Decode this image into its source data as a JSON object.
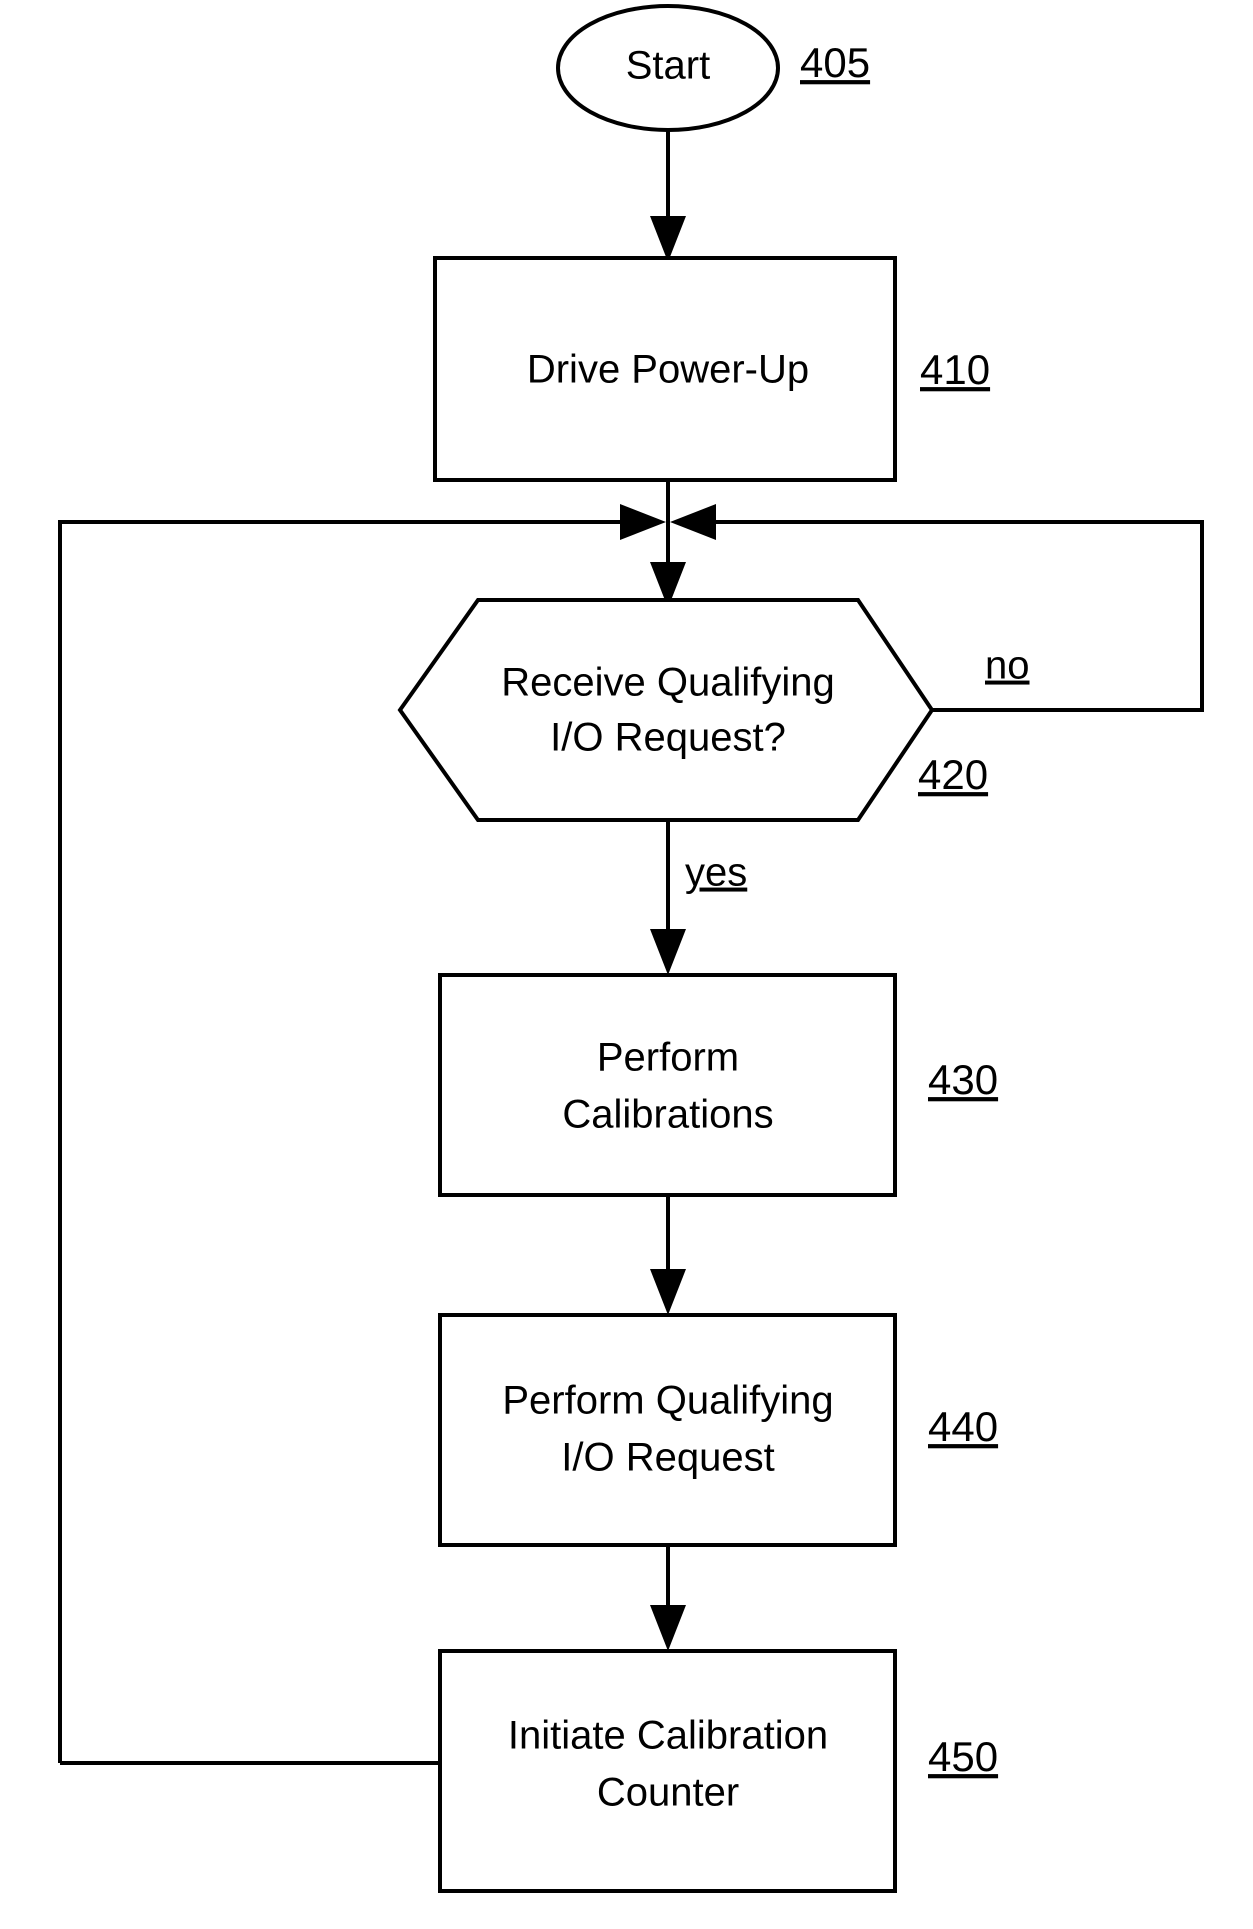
{
  "document": {
    "kind": "patent-flowchart",
    "background_color": "#ffffff",
    "line_color": "#000000"
  },
  "nodes": [
    {
      "id": "start",
      "shape": "ellipse",
      "lines": [
        "Start"
      ],
      "ref": "405"
    },
    {
      "id": "drive-power-up",
      "shape": "rectangle",
      "lines": [
        "Drive Power-Up"
      ],
      "ref": "410"
    },
    {
      "id": "receive-qualifying-io-request",
      "shape": "hexagon",
      "lines": [
        "Receive Qualifying",
        "I/O Request?"
      ],
      "ref": "420"
    },
    {
      "id": "perform-calibrations",
      "shape": "rectangle",
      "lines": [
        "Perform",
        "Calibrations"
      ],
      "ref": "430"
    },
    {
      "id": "perform-qualifying-io-request",
      "shape": "rectangle",
      "lines": [
        "Perform Qualifying",
        "I/O Request"
      ],
      "ref": "440"
    },
    {
      "id": "initiate-calibration-counter",
      "shape": "rectangle",
      "lines": [
        "Initiate Calibration",
        "Counter"
      ],
      "ref": "450"
    }
  ],
  "edge_labels": {
    "decision_no": "no",
    "decision_yes": "yes"
  },
  "text": {
    "start_line1": "Start",
    "start_ref": "405",
    "drive_power_up_line1": "Drive Power-Up",
    "drive_power_up_ref": "410",
    "decision_line1": "Receive Qualifying",
    "decision_line2": "I/O Request?",
    "decision_ref": "420",
    "calibrations_line1": "Perform",
    "calibrations_line2": "Calibrations",
    "calibrations_ref": "430",
    "qualifying_line1": "Perform Qualifying",
    "qualifying_line2": "I/O Request",
    "qualifying_ref": "440",
    "counter_line1": "Initiate Calibration",
    "counter_line2": "Counter",
    "counter_ref": "450",
    "label_no": "no",
    "label_yes": "yes"
  }
}
